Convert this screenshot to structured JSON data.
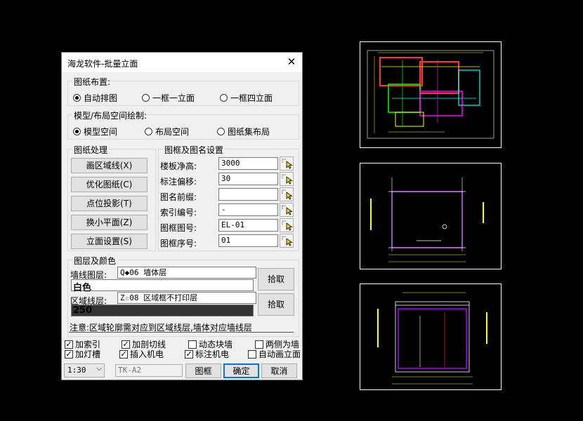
{
  "dialog": {
    "title": "海龙软件-批量立面",
    "close_glyph": "✕",
    "layout_group": {
      "label": "图纸布置:",
      "options": [
        "自动排图",
        "一框一立面",
        "一框四立面"
      ]
    },
    "space_group": {
      "label": "模型/布局空间绘制:",
      "options": [
        "模型空间",
        "布局空间",
        "图纸集布局"
      ]
    },
    "processing": {
      "label": "图纸处理",
      "buttons": [
        "画区域线(X)",
        "优化图纸(C)",
        "点位投影(T)",
        "换小平面(Z)",
        "立面设置(S)"
      ]
    },
    "frame_settings": {
      "label": "图框及图名设置",
      "fields": [
        {
          "label": "楼板净高:",
          "value": "3000"
        },
        {
          "label": "标注偏移:",
          "value": "30"
        },
        {
          "label": "图名前缀:",
          "value": ""
        },
        {
          "label": "索引编号:",
          "value": "-"
        },
        {
          "label": "图框图号:",
          "value": "EL-01"
        },
        {
          "label": "图框序号:",
          "value": "01"
        }
      ]
    },
    "layers": {
      "label": "图层及颜色",
      "wall_label": "墙线图层:",
      "wall_layer": "Q◆06 墙体层",
      "wall_color_name": "白色",
      "region_label": "区域线层:",
      "region_layer": "Z☆08 区域框不打印层",
      "region_color_name": "250",
      "pick_label": "拾取"
    },
    "note": "注意:区域轮廓需对应到区域线层,墙体对应墙线层",
    "checkboxes": [
      {
        "label": "加索引",
        "checked": true
      },
      {
        "label": "加剖切线",
        "checked": true
      },
      {
        "label": "动态块墙",
        "checked": false
      },
      {
        "label": "两侧为墙",
        "checked": false
      },
      {
        "label": "加灯槽",
        "checked": true
      },
      {
        "label": "插入机电",
        "checked": true
      },
      {
        "label": "标注机电",
        "checked": true
      },
      {
        "label": "自动画立面",
        "checked": false
      }
    ],
    "scale": "1:30",
    "frame_name": "TK-A2",
    "frame_button": "图框",
    "ok_button": "确定",
    "cancel_button": "取消",
    "colors": {
      "accent": "#0078d7",
      "note_underline": "#e5006a",
      "region_color_swatch": "#333333"
    }
  }
}
